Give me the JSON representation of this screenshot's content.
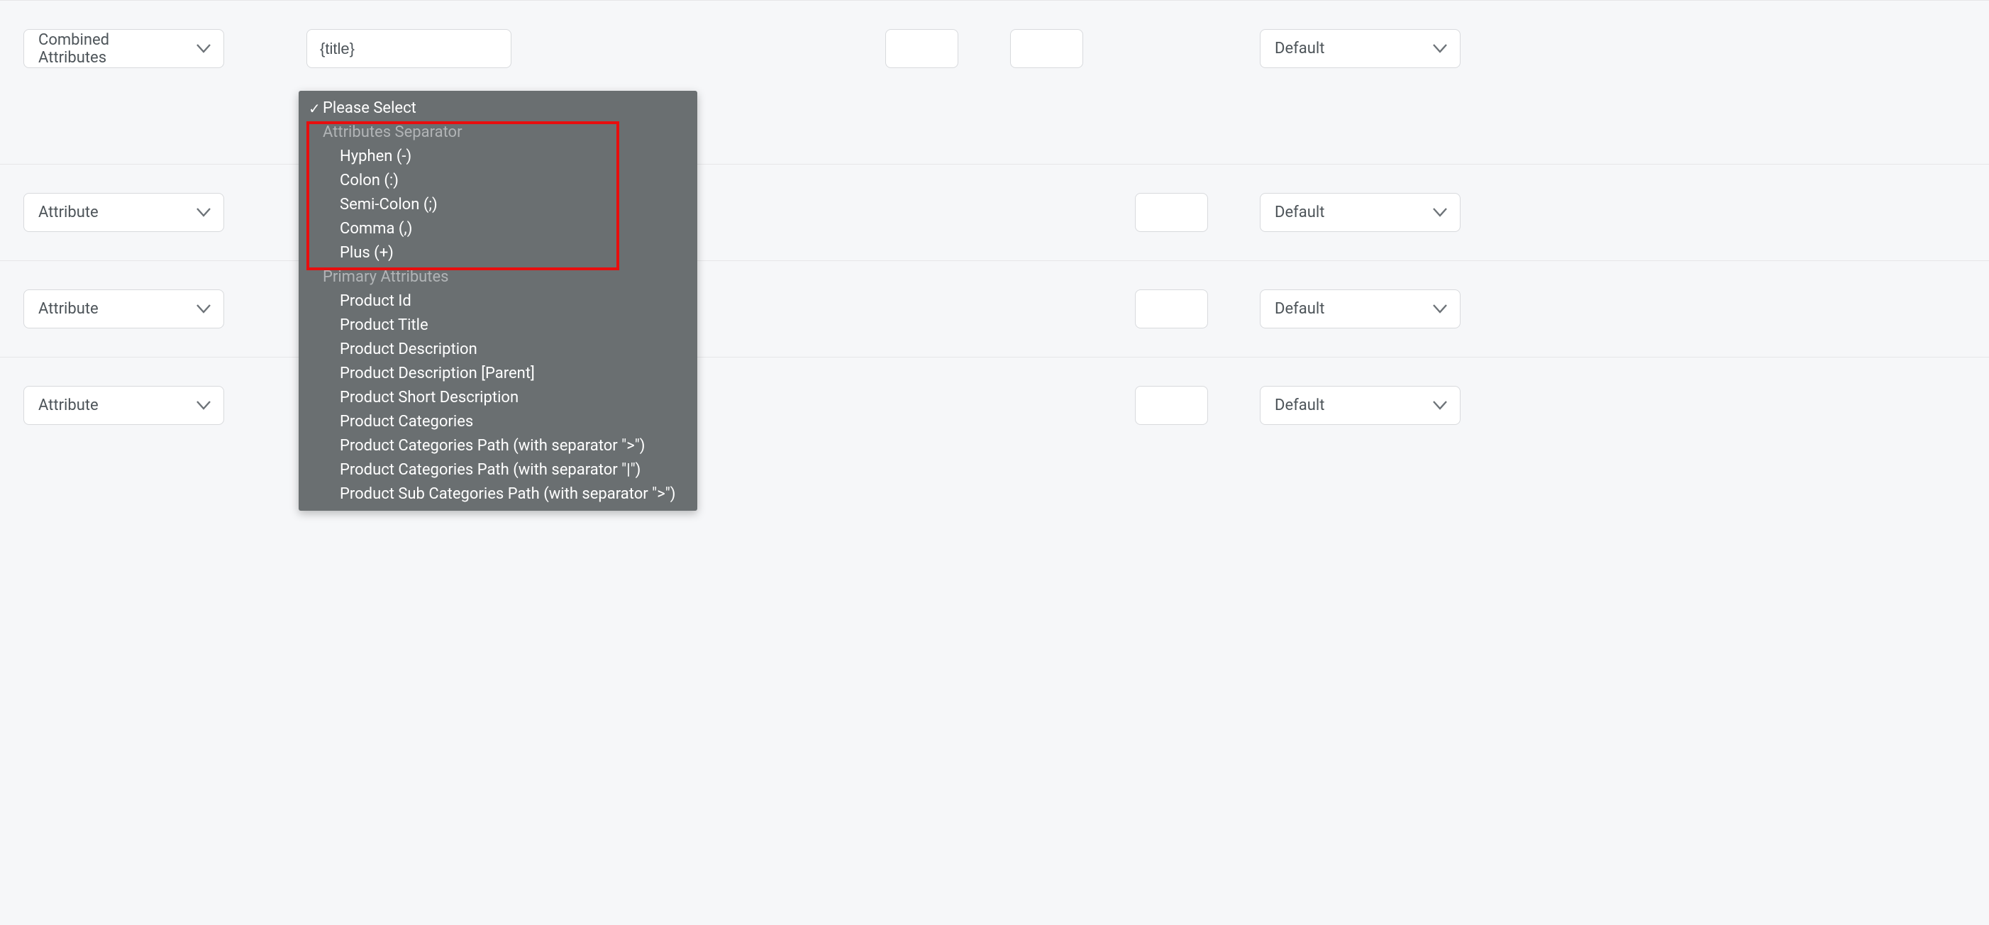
{
  "rows": [
    {
      "type_label": "Combined Attributes",
      "value": "{title}",
      "output_label": "Default"
    },
    {
      "type_label": "Attribute",
      "value": "",
      "output_label": "Default"
    },
    {
      "type_label": "Attribute",
      "value": "",
      "output_label": "Default"
    },
    {
      "type_label": "Attribute",
      "value": "",
      "output_label": "Default"
    }
  ],
  "dropdown": {
    "selected": "Please Select",
    "groups": [
      {
        "name": "Attributes Separator",
        "options": [
          "Hyphen (-)",
          "Colon (:)",
          "Semi-Colon (;)",
          "Comma (,)",
          "Plus (+)"
        ]
      },
      {
        "name": "Primary Attributes",
        "options": [
          "Product Id",
          "Product Title",
          "Product Description",
          "Product Description [Parent]",
          "Product Short Description",
          "Product Categories",
          "Product Categories Path (with separator \">\")",
          "Product Categories Path (with separator \"|\")",
          "Product Sub Categories Path (with separator \">\")"
        ]
      }
    ]
  }
}
